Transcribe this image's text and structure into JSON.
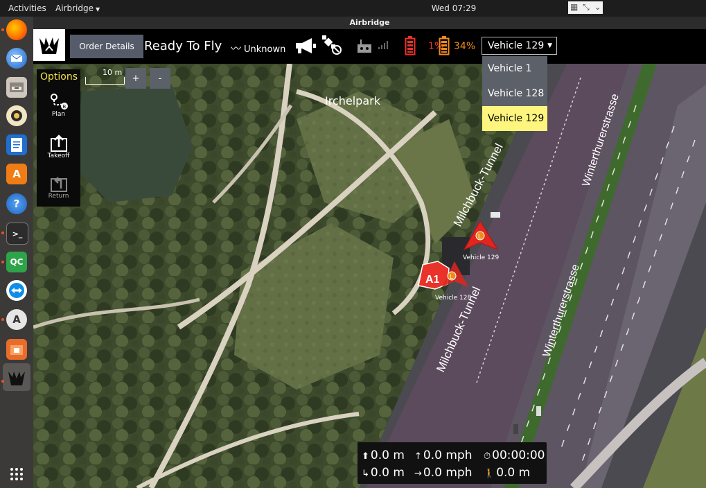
{
  "topbar": {
    "activities": "Activities",
    "app_name": "Airbridge",
    "clock": "Wed 07:29"
  },
  "window": {
    "title": "Airbridge"
  },
  "dock": {
    "items": [
      {
        "name": "firefox-icon",
        "glyph": ""
      },
      {
        "name": "thunderbird-icon",
        "glyph": ""
      },
      {
        "name": "files-icon",
        "glyph": ""
      },
      {
        "name": "rhythmbox-icon",
        "glyph": ""
      },
      {
        "name": "libreoffice-writer-icon",
        "glyph": ""
      },
      {
        "name": "software-center-icon",
        "glyph": "A"
      },
      {
        "name": "help-icon",
        "glyph": "?"
      },
      {
        "name": "terminal-icon",
        "glyph": ">_"
      },
      {
        "name": "qgroundcontrol-icon",
        "glyph": "QC"
      },
      {
        "name": "teamviewer-icon",
        "glyph": ""
      },
      {
        "name": "software-updater-icon",
        "glyph": "A"
      },
      {
        "name": "file-roller-icon",
        "glyph": ""
      },
      {
        "name": "airbridge-icon",
        "glyph": ""
      }
    ],
    "show_apps_icon": "grid-icon"
  },
  "header": {
    "order_button": "Order Details",
    "status": "Ready To Fly",
    "flight_mode": "Unknown",
    "battery_1": "1%",
    "battery_2": "34%",
    "vehicle_select": "Vehicle 129"
  },
  "map": {
    "scale_label": "10 m",
    "zoom_in": "+",
    "zoom_out": "-",
    "place_label": "Irchelpark",
    "road_labels": [
      "Milchbuck-Tunnel",
      "Milchbuck-Tunnel",
      "Winterthurerstrasse",
      "Winterthurerstrasse"
    ],
    "shield_label": "A1"
  },
  "options": {
    "title": "Options",
    "items": [
      {
        "label": "Plan",
        "icon": "plan-route-icon"
      },
      {
        "label": "Takeoff",
        "icon": "takeoff-icon"
      },
      {
        "label": "Return",
        "icon": "return-icon"
      }
    ]
  },
  "dropdown": {
    "items": [
      "Vehicle 1",
      "Vehicle 128",
      "Vehicle 129"
    ],
    "selected": "Vehicle 129"
  },
  "vehicles": [
    {
      "label": "Vehicle 129",
      "badge": "L"
    },
    {
      "label": "Vehicle 128",
      "badge": "L"
    }
  ],
  "telemetry": {
    "altitude": "0.0 m",
    "vertical_speed": "0.0 mph",
    "flight_time": "00:00:00",
    "home_distance": "0.0 m",
    "ground_speed": "0.0 mph",
    "walk_distance": "0.0 m"
  },
  "colors": {
    "accent_yellow": "#f5e14a",
    "battery_red": "#e8322a",
    "battery_orange": "#f08a19",
    "dropdown_selected": "#fdf57e",
    "button_gray": "#565b6a"
  }
}
